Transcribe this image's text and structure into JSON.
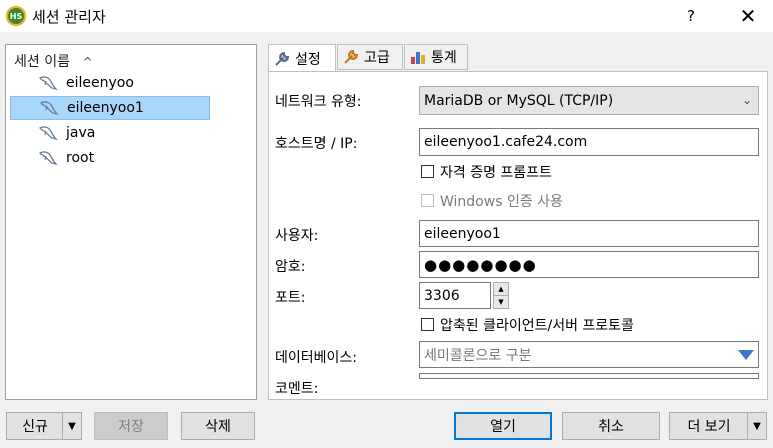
{
  "window": {
    "app_icon_text": "HS",
    "title": "세션 관리자",
    "help": "?",
    "close": "✕"
  },
  "tree": {
    "header": "세션 이름",
    "sort_icon": "^",
    "items": [
      {
        "label": "eileenyoo",
        "selected": false
      },
      {
        "label": "eileenyoo1",
        "selected": true
      },
      {
        "label": "java",
        "selected": false
      },
      {
        "label": "root",
        "selected": false
      }
    ]
  },
  "tabs": [
    {
      "label": "설정",
      "icon": "wrench-icon",
      "active": true
    },
    {
      "label": "고급",
      "icon": "wrench-orange-icon",
      "active": false
    },
    {
      "label": "통계",
      "icon": "bar-chart-icon",
      "active": false
    }
  ],
  "form": {
    "network_type_label": "네트워크 유형:",
    "network_type_value": "MariaDB or MySQL (TCP/IP)",
    "host_label": "호스트명 / IP:",
    "host_value": "eileenyoo1.cafe24.com",
    "cred_prompt_label": "자격 증명 프롬프트",
    "windows_auth_label": "Windows 인증 사용",
    "user_label": "사용자:",
    "user_value": "eileenyoo1",
    "password_label": "암호:",
    "password_value": "●●●●●●●●",
    "port_label": "포트:",
    "port_value": "3306",
    "compression_label": "압축된 클라이언트/서버 프로토콜",
    "database_label": "데이터베이스:",
    "database_placeholder": "세미콜론으로 구분",
    "comment_label": "코멘트:"
  },
  "buttons": {
    "new": "신규",
    "save": "저장",
    "delete": "삭제",
    "open": "열기",
    "cancel": "취소",
    "more": "더 보기"
  },
  "colors": {
    "selection": "#a9d6fb",
    "primary_border": "#0078d7",
    "dropdown_arrow": "#3a78c9"
  }
}
